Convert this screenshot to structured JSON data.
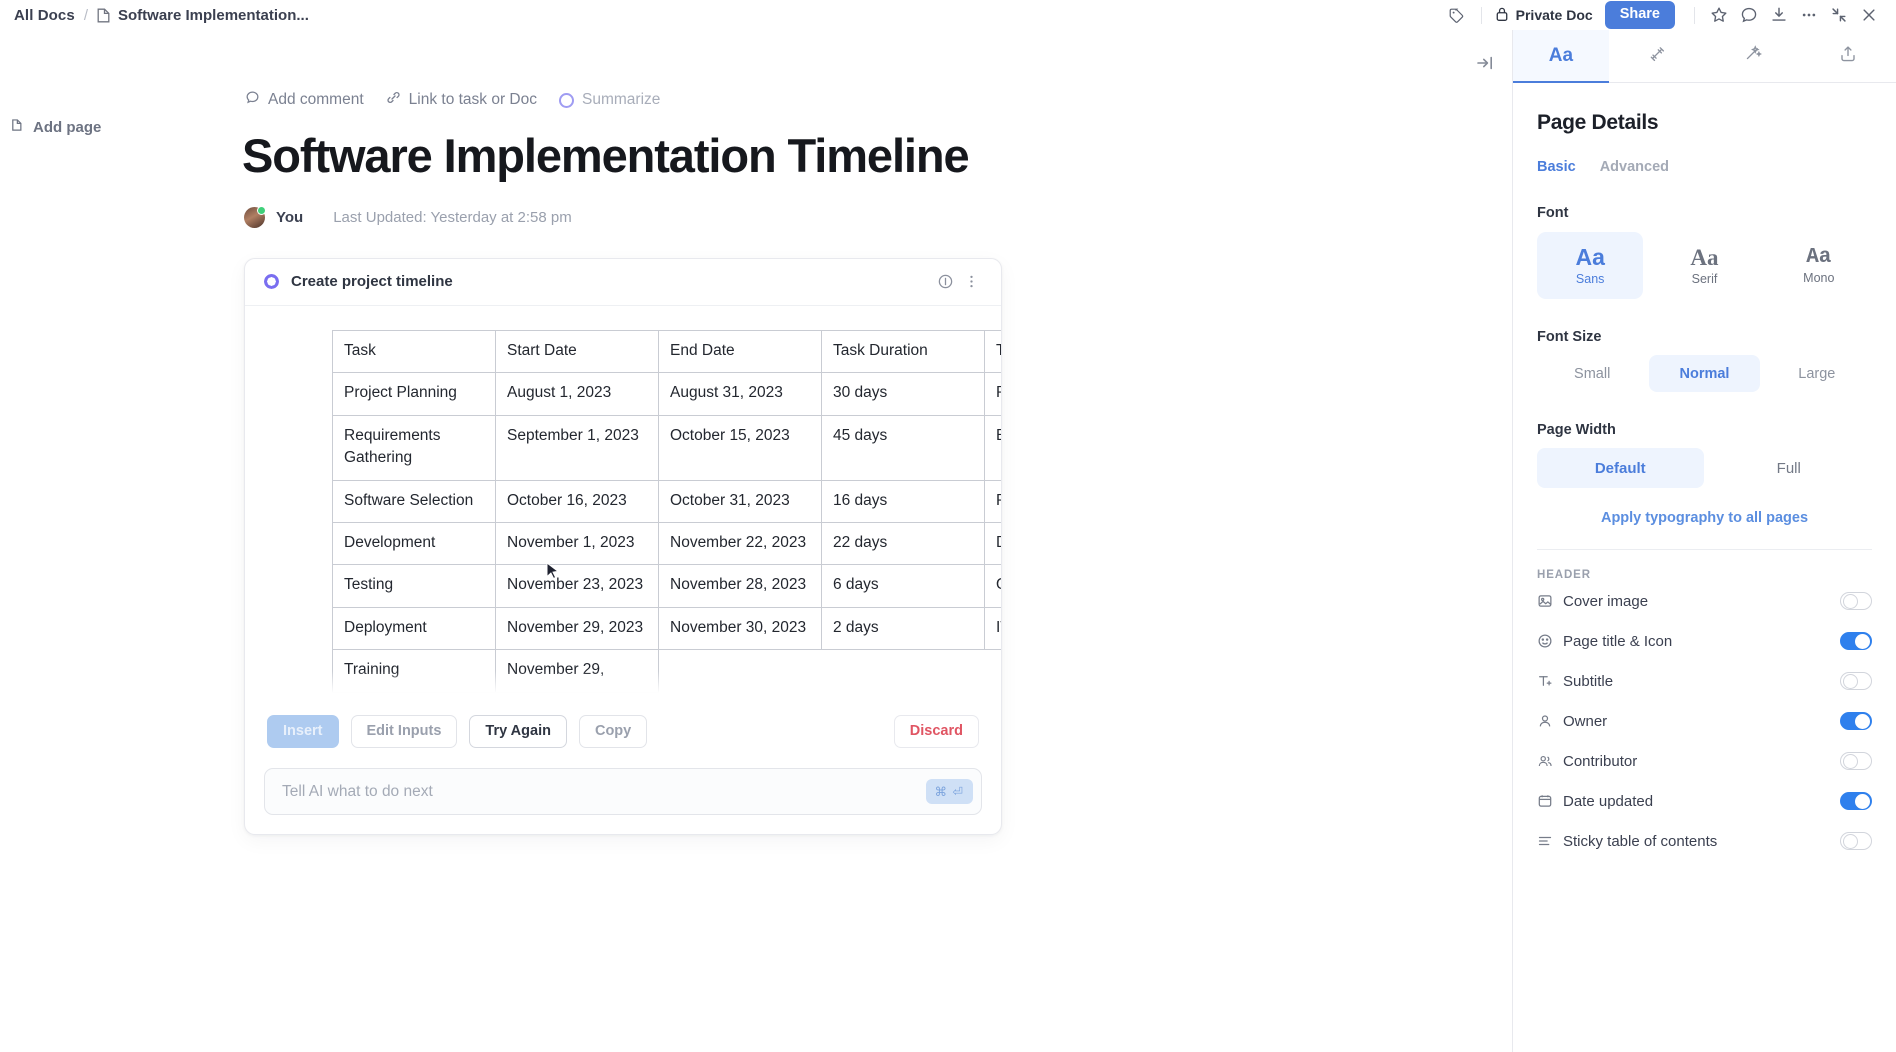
{
  "topbar": {
    "breadcrumb_root": "All Docs",
    "breadcrumb_sep": "/",
    "breadcrumb_doc": "Software Implementation...",
    "privacy_label": "Private Doc",
    "share_label": "Share",
    "icons": [
      "tag-icon",
      "star-icon",
      "comment-icon",
      "import-icon",
      "ellipsis-icon",
      "collapse-icon",
      "close-icon"
    ]
  },
  "leftrail": {
    "add_page_label": "Add page"
  },
  "doc": {
    "actions": [
      {
        "label": "Add comment",
        "icon": "comment-icon"
      },
      {
        "label": "Link to task or Doc",
        "icon": "link-icon"
      },
      {
        "label": "Summarize",
        "icon": "sparkle-ring-icon"
      }
    ],
    "title": "Software Implementation Timeline",
    "author": "You",
    "last_updated": "Last Updated: Yesterday at 2:58 pm"
  },
  "ai_card": {
    "prompt_title": "Create project timeline",
    "buttons": {
      "insert": "Insert",
      "edit_inputs": "Edit Inputs",
      "try_again": "Try Again",
      "copy": "Copy",
      "discard": "Discard"
    },
    "input_placeholder": "Tell AI what to do next",
    "send_key_label": "⌘ ⏎"
  },
  "table": {
    "headers": [
      "Task",
      "Start Date",
      "End Date",
      "Task Duration",
      "Task Owner"
    ],
    "rows": [
      [
        "Project Planning",
        "August 1, 2023",
        "August 31, 2023",
        "30 days",
        "Project Manager"
      ],
      [
        "Requirements Gathering",
        "September 1, 2023",
        "October 15, 2023",
        "45 days",
        "Business Analyst"
      ],
      [
        "Software Selection",
        "October 16, 2023",
        "October 31, 2023",
        "16 days",
        "Procurement"
      ],
      [
        "Development",
        "November 1, 2023",
        "November 22, 2023",
        "22 days",
        "Dev Team"
      ],
      [
        "Testing",
        "November 23, 2023",
        "November 28, 2023",
        "6 days",
        "QA Team"
      ],
      [
        "Deployment",
        "November 29, 2023",
        "November 30, 2023",
        "2 days",
        "IT Ops"
      ],
      [
        "Training",
        "November 29,",
        "",
        "",
        ""
      ]
    ]
  },
  "right_panel": {
    "tabs": [
      {
        "name": "typography",
        "label": "Aa",
        "active": true
      },
      {
        "name": "relationships",
        "label": "",
        "active": false
      },
      {
        "name": "ai-tools",
        "label": "",
        "active": false
      },
      {
        "name": "share-export",
        "label": "",
        "active": false
      }
    ],
    "title": "Page Details",
    "subtabs": [
      {
        "label": "Basic",
        "active": true
      },
      {
        "label": "Advanced",
        "active": false
      }
    ],
    "font_section_label": "Font",
    "font_options": [
      {
        "sample": "Aa",
        "label": "Sans",
        "active": true
      },
      {
        "sample": "Aa",
        "label": "Serif",
        "active": false
      },
      {
        "sample": "Aa",
        "label": "Mono",
        "active": false
      }
    ],
    "font_size_label": "Font Size",
    "font_sizes": [
      {
        "label": "Small",
        "active": false
      },
      {
        "label": "Normal",
        "active": true
      },
      {
        "label": "Large",
        "active": false
      }
    ],
    "page_width_label": "Page Width",
    "page_widths": [
      {
        "label": "Default",
        "active": true
      },
      {
        "label": "Full",
        "active": false
      }
    ],
    "apply_link": "Apply typography to all pages",
    "header_group_label": "HEADER",
    "header_toggles": [
      {
        "label": "Cover image",
        "icon": "image-icon",
        "on": false
      },
      {
        "label": "Page title & Icon",
        "icon": "smiley-icon",
        "on": true
      },
      {
        "label": "Subtitle",
        "icon": "text-add-icon",
        "on": false
      },
      {
        "label": "Owner",
        "icon": "person-icon",
        "on": true
      },
      {
        "label": "Contributor",
        "icon": "people-icon",
        "on": false
      },
      {
        "label": "Date updated",
        "icon": "calendar-icon",
        "on": true
      },
      {
        "label": "Sticky table of contents",
        "icon": "list-icon",
        "on": false
      }
    ]
  },
  "colors": {
    "accent": "#4b7ddb",
    "share_bg": "#2f80ed",
    "discard": "#e05563",
    "toggle_on": "#2f80ed"
  }
}
